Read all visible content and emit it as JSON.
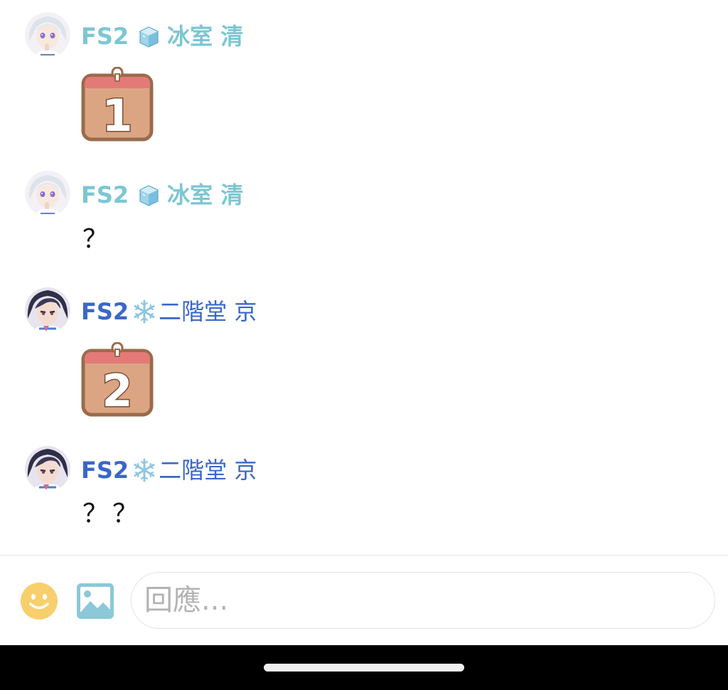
{
  "messages": [
    {
      "author": {
        "prefix": "FS2",
        "icon": "ice-cube-icon",
        "given": "冰室 清",
        "color": "#7cc6d2"
      },
      "sticker": {
        "label": "1",
        "icon": "calendar-day-1-sticker"
      }
    },
    {
      "author": {
        "prefix": "FS2",
        "icon": "ice-cube-icon",
        "given": "冰室 清",
        "color": "#7cc6d2"
      },
      "text": "？"
    },
    {
      "author": {
        "prefix": "FS2",
        "icon": "snowflake-icon",
        "given": "二階堂 京",
        "color": "#3a67c9"
      },
      "sticker": {
        "label": "2",
        "icon": "calendar-day-2-sticker"
      }
    },
    {
      "author": {
        "prefix": "FS2",
        "icon": "snowflake-icon",
        "given": "二階堂 京",
        "color": "#3a67c9"
      },
      "text": "？？"
    }
  ],
  "composer": {
    "placeholder": "回應...",
    "value": "",
    "emoji_icon": "smiley-face-icon",
    "image_icon": "image-picker-icon"
  },
  "colors": {
    "accent_cyan": "#7cc6d2",
    "accent_blue": "#3a67c9",
    "sticker_fill": "#dba583",
    "sticker_border": "#9a6b4b",
    "sticker_top": "#e47a78",
    "emoji_yellow": "#f7cf6d",
    "image_blue": "#8cc8d8"
  }
}
